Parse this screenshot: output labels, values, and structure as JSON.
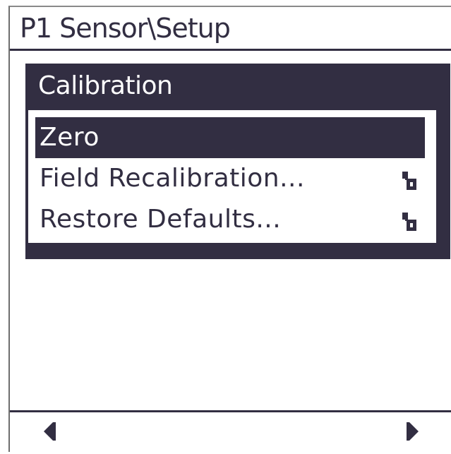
{
  "header": {
    "title": "P1 Sensor\\Setup"
  },
  "dialog": {
    "title": "Calibration",
    "items": [
      {
        "label": "Zero",
        "selected": true,
        "locked": false
      },
      {
        "label": "Field Recalibration...",
        "selected": false,
        "locked": true,
        "icon": "lock-open-icon"
      },
      {
        "label": "Restore Defaults...",
        "selected": false,
        "locked": true,
        "icon": "lock-open-icon"
      }
    ]
  },
  "footer": {
    "left_icon": "left-arrow-icon",
    "right_icon": "right-arrow-icon"
  },
  "colors": {
    "foreground": "#322e42",
    "background": "#ffffff",
    "selection": "#322e42"
  }
}
